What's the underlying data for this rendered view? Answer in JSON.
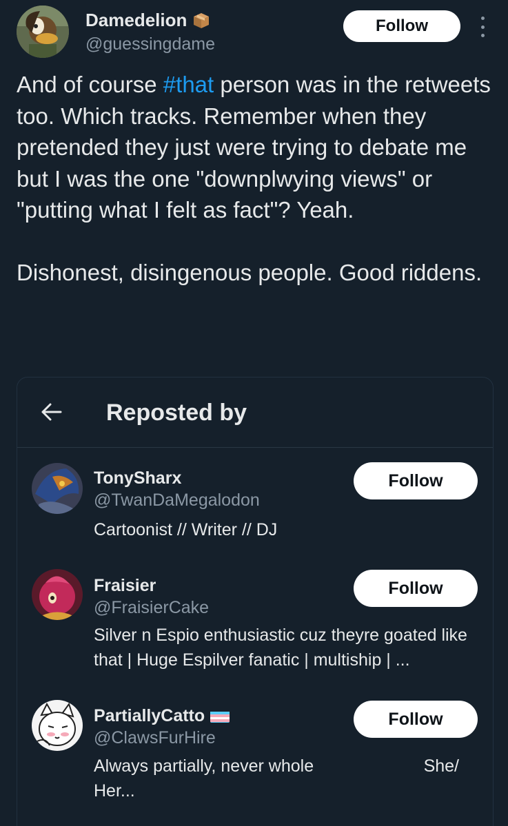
{
  "post": {
    "author_name": "Damedelion",
    "author_badge_icon": "package-emoji",
    "author_handle": "@guessingdame",
    "follow_label": "Follow",
    "text_part1": "And of course ",
    "hashtag": "#that",
    "text_part2": " person was in the retweets too. Which tracks. Remember when they pretended they just were trying to debate me but I was the one \"downplwying views\" or \"putting what I felt as fact\"? Yeah.",
    "text_paragraph2": "Dishonest, disingenous people. Good riddens."
  },
  "reposted_panel": {
    "title": "Reposted by",
    "back_icon": "arrow-left-icon",
    "users": [
      {
        "name": "TonySharx",
        "handle": "@TwanDaMegalodon",
        "bio": "Cartoonist // Writer // DJ",
        "follow_label": "Follow"
      },
      {
        "name": "Fraisier",
        "handle": "@FraisierCake",
        "bio": "Silver n Espio enthusiastic cuz theyre goated like that | Huge Espilver fanatic | multiship | ...",
        "follow_label": "Follow"
      },
      {
        "name": "PartiallyCatto",
        "name_badge_icon": "transgender-flag-emoji",
        "handle": "@ClawsFurHire",
        "bio_left": "Always partially, never whole",
        "bio_right": "She/",
        "bio_line2": "Her...",
        "follow_label": "Follow"
      }
    ]
  },
  "colors": {
    "background": "#15202b",
    "text": "#e7e9ea",
    "secondary": "#8b98a5",
    "hashtag": "#1d9bf0",
    "button_bg": "#ffffff"
  }
}
